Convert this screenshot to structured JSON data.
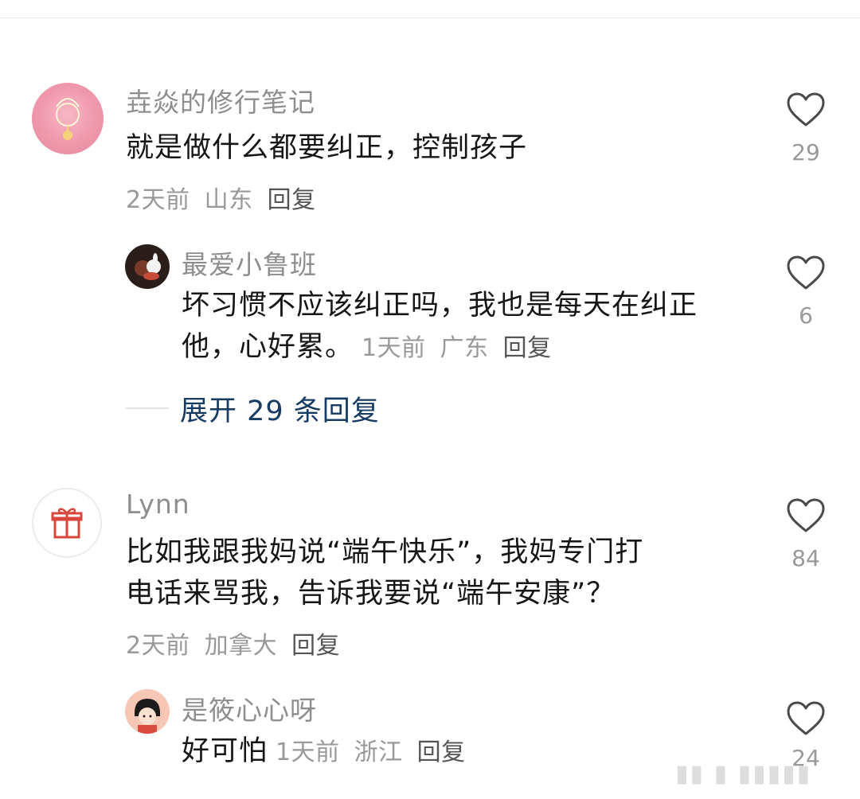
{
  "comments": [
    {
      "username": "垚焱的修行笔记",
      "text": "就是做什么都要纠正，控制孩子",
      "time": "2天前",
      "location": "山东",
      "reply_label": "回复",
      "likes": "29",
      "replies": [
        {
          "username": "最爱小鲁班",
          "text_line1": "坏习惯不应该纠正吗，我也是每天在纠正",
          "text_line2": "他，心好累。",
          "time": "1天前",
          "location": "广东",
          "reply_label": "回复",
          "likes": "6"
        }
      ],
      "expand_label": "展开 29 条回复"
    },
    {
      "username": "Lynn",
      "text_line1": "比如我跟我妈说“端午快乐”，我妈专门打",
      "text_line2": "电话来骂我，告诉我要说“端午安康”？",
      "time": "2天前",
      "location": "加拿大",
      "reply_label": "回复",
      "likes": "84",
      "replies": [
        {
          "username": "是筱心心呀",
          "text": "好可怕",
          "time": "1天前",
          "location": "浙江",
          "reply_label": "回复",
          "likes": "24"
        }
      ]
    }
  ],
  "colors": {
    "username": "#8e8e8e",
    "meta": "#999999",
    "expand": "#173b62",
    "heart": "#4a4a4a"
  },
  "icons": [
    "heart-outline-icon",
    "gift-icon"
  ]
}
